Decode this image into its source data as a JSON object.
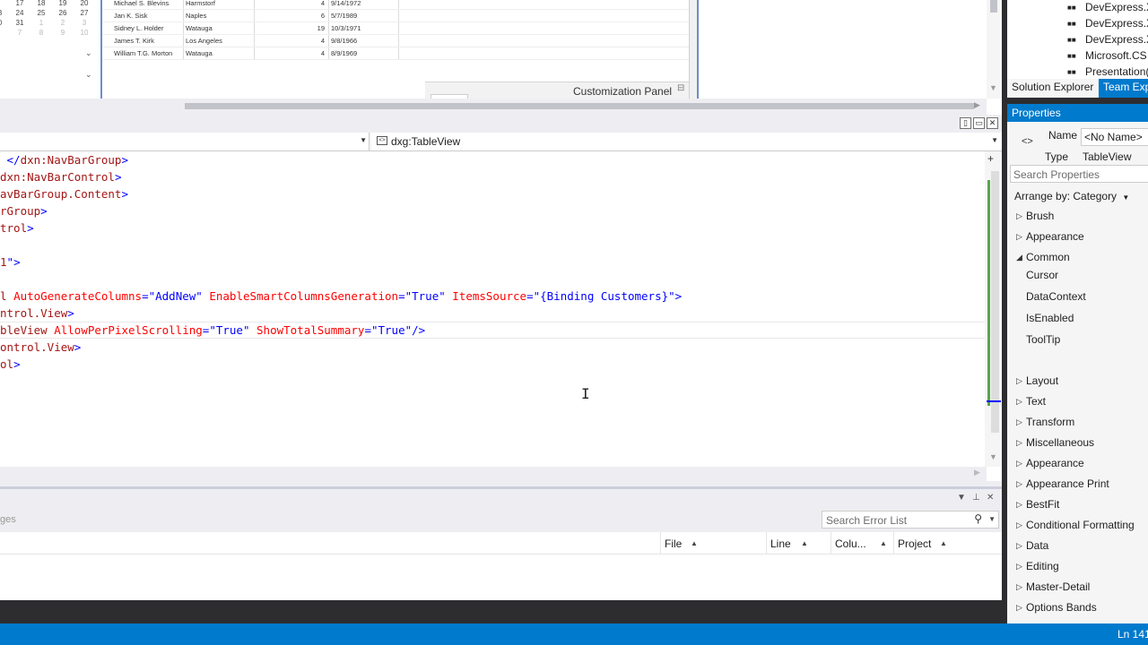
{
  "designer": {
    "calendar": {
      "rows": [
        [
          {
            "d": "17",
            "dim": false
          },
          {
            "d": "18",
            "dim": false
          },
          {
            "d": "19",
            "dim": false
          },
          {
            "d": "20",
            "dim": false
          }
        ],
        [
          {
            "d": "3",
            "dim": false
          },
          {
            "d": "24",
            "dim": false
          },
          {
            "d": "25",
            "dim": false
          },
          {
            "d": "26",
            "dim": false
          },
          {
            "d": "27",
            "dim": false
          }
        ],
        [
          {
            "d": "0",
            "dim": false
          },
          {
            "d": "31",
            "dim": false
          },
          {
            "d": "1",
            "dim": true
          },
          {
            "d": "2",
            "dim": true
          },
          {
            "d": "3",
            "dim": true
          }
        ],
        [
          {
            "d": "",
            "dim": true
          },
          {
            "d": "7",
            "dim": true
          },
          {
            "d": "8",
            "dim": true
          },
          {
            "d": "9",
            "dim": true
          },
          {
            "d": "10",
            "dim": true
          }
        ]
      ]
    },
    "grid_rows": [
      {
        "name": "Michael S. Blevins",
        "city": "Harmstorf",
        "num": "4",
        "date": "9/14/1972"
      },
      {
        "name": "Jan K. Sisk",
        "city": "Naples",
        "num": "6",
        "date": "5/7/1989"
      },
      {
        "name": "Sidney L. Holder",
        "city": "Watauga",
        "num": "19",
        "date": "10/3/1971"
      },
      {
        "name": "James T. Kirk",
        "city": "Los Angeles",
        "num": "4",
        "date": "9/8/1966"
      },
      {
        "name": "William T.G. Morton",
        "city": "Watauga",
        "num": "4",
        "date": "8/9/1969"
      }
    ],
    "customization_panel": "Customization Panel"
  },
  "navbar": {
    "left_value": "",
    "right_value": "dxg:TableView"
  },
  "editor": {
    "lines": [
      [
        {
          "c": "br",
          "t": " </"
        },
        {
          "c": "tag",
          "t": "dxn:NavBarGroup"
        },
        {
          "c": "br",
          "t": ">"
        }
      ],
      [
        {
          "c": "tag",
          "t": "dxn:NavBarControl"
        },
        {
          "c": "br",
          "t": ">"
        }
      ],
      [
        {
          "c": "tag",
          "t": "avBarGroup.Content"
        },
        {
          "c": "br",
          "t": ">"
        }
      ],
      [
        {
          "c": "tag",
          "t": "rGroup"
        },
        {
          "c": "br",
          "t": ">"
        }
      ],
      [
        {
          "c": "tag",
          "t": "trol"
        },
        {
          "c": "br",
          "t": ">"
        }
      ],
      [],
      [
        {
          "c": "tag",
          "t": "1"
        },
        {
          "c": "val",
          "t": "\""
        },
        {
          "c": "br",
          "t": ">"
        }
      ],
      [],
      [
        {
          "c": "tag",
          "t": "l "
        },
        {
          "c": "attr",
          "t": "AutoGenerateColumns"
        },
        {
          "c": "br",
          "t": "="
        },
        {
          "c": "val",
          "t": "\"AddNew\""
        },
        {
          "c": "br",
          "t": " "
        },
        {
          "c": "attr",
          "t": "EnableSmartColumnsGeneration"
        },
        {
          "c": "br",
          "t": "="
        },
        {
          "c": "val",
          "t": "\"True\""
        },
        {
          "c": "br",
          "t": " "
        },
        {
          "c": "attr",
          "t": "ItemsSource"
        },
        {
          "c": "br",
          "t": "="
        },
        {
          "c": "val",
          "t": "\"{Binding Customers}\""
        },
        {
          "c": "br",
          "t": ">"
        }
      ],
      [
        {
          "c": "tag",
          "t": "ntrol.View"
        },
        {
          "c": "br",
          "t": ">"
        }
      ],
      [
        {
          "c": "tag",
          "t": "bleView "
        },
        {
          "c": "attr",
          "t": "AllowPerPixelScrolling"
        },
        {
          "c": "br",
          "t": "="
        },
        {
          "c": "val",
          "t": "\"True\""
        },
        {
          "c": "br",
          "t": " "
        },
        {
          "c": "attr",
          "t": "ShowTotalSummary"
        },
        {
          "c": "br",
          "t": "="
        },
        {
          "c": "val",
          "t": "\"True\""
        },
        {
          "c": "br",
          "t": "/>"
        }
      ],
      [
        {
          "c": "tag",
          "t": "ontrol.View"
        },
        {
          "c": "br",
          "t": ">"
        }
      ],
      [
        {
          "c": "tag",
          "t": "ol"
        },
        {
          "c": "br",
          "t": ">"
        }
      ]
    ]
  },
  "error_list": {
    "messages_label": "ges",
    "search_placeholder": "Search Error List",
    "columns": [
      "File",
      "Line",
      "Colu...",
      "Project"
    ]
  },
  "solution_explorer": {
    "items": [
      "DevExpress.X",
      "DevExpress.X",
      "DevExpress.X",
      "Microsoft.CS",
      "Presentation("
    ],
    "tabs": [
      "Solution Explorer",
      "Team Exp"
    ]
  },
  "properties": {
    "title": "Properties",
    "name_label": "Name",
    "name_value": "<No Name>",
    "type_label": "Type",
    "type_value": "TableView",
    "search_placeholder": "Search Properties",
    "arrange_by": "Arrange by: Category",
    "categories_before": [
      {
        "label": "Brush",
        "expanded": false
      },
      {
        "label": "Appearance",
        "expanded": false
      },
      {
        "label": "Common",
        "expanded": true
      }
    ],
    "common_items": [
      "Cursor",
      "DataContext",
      "IsEnabled",
      "ToolTip"
    ],
    "categories_after": [
      "Layout",
      "Text",
      "Transform",
      "Miscellaneous",
      "Appearance",
      "Appearance Print",
      "BestFit",
      "Conditional Formatting",
      "Data",
      "Editing",
      "Master-Detail",
      "Options Bands"
    ]
  },
  "status_bar": {
    "line_indicator": "Ln 141"
  },
  "colors": {
    "accent": "#007acc",
    "chrome_dark": "#2d2d30",
    "xaml_tag": "#a31515",
    "xaml_attr": "#ff0000",
    "xaml_value": "#0000ff"
  }
}
